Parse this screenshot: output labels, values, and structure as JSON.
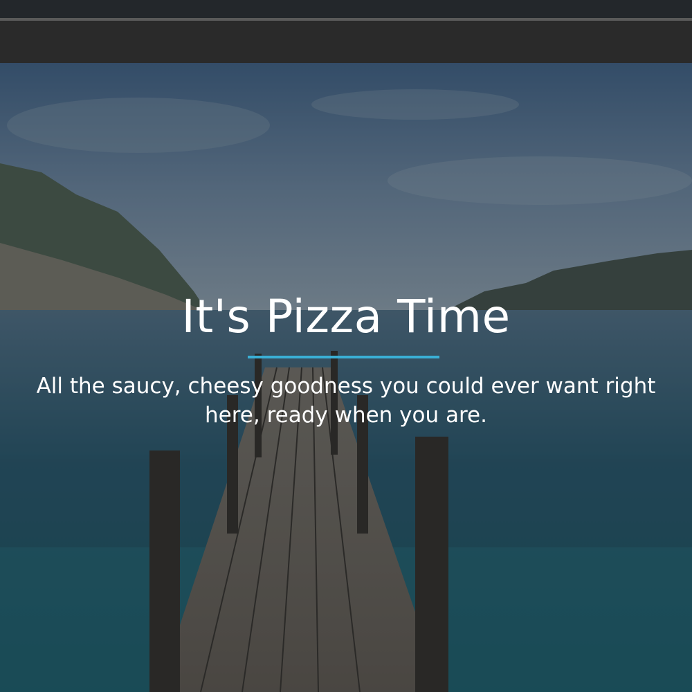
{
  "hero": {
    "title": "It's Pizza Time",
    "subtitle": "All the saucy, cheesy goodness you could ever want right here, ready when you are.",
    "background_image": "lake-pier-photo"
  },
  "colors": {
    "accent_rule": "#3ab0d6",
    "header_bg": "#2a2a2a",
    "text": "#ffffff"
  }
}
